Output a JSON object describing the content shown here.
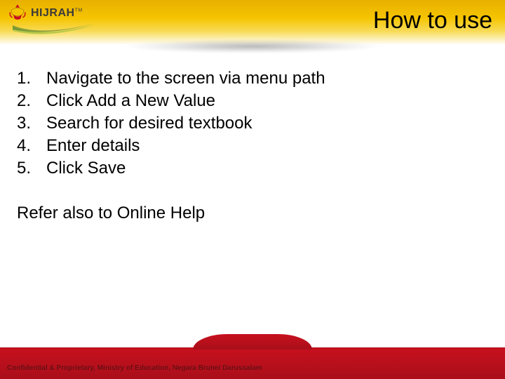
{
  "logo": {
    "text": "HIJRAH",
    "tm": "TM"
  },
  "title": "How to use",
  "steps": [
    {
      "num": "1.",
      "text": "Navigate to the screen via menu path"
    },
    {
      "num": "2.",
      "text": "Click Add a New Value"
    },
    {
      "num": "3.",
      "text": "Search for desired textbook"
    },
    {
      "num": "4.",
      "text": "Enter details"
    },
    {
      "num": "5.",
      "text": "Click Save"
    }
  ],
  "refer": "Refer also to Online Help",
  "footer": "Confidential & Proprietary, Ministry of Education, Negara Brunei Darussalam"
}
